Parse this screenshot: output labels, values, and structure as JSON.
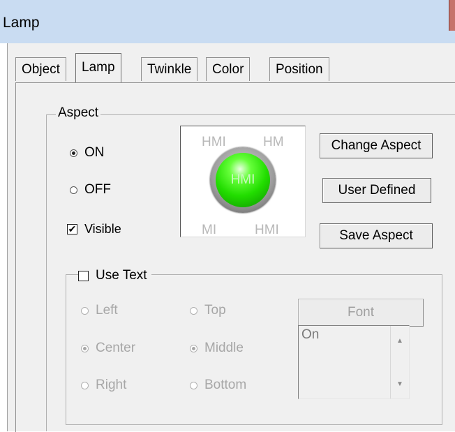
{
  "window": {
    "title": "Lamp"
  },
  "tabs": [
    "Object",
    "Lamp",
    "Twinkle",
    "Color",
    "Position"
  ],
  "active_tab": "Lamp",
  "aspect": {
    "group_label": "Aspect",
    "on_label": "ON",
    "off_label": "OFF",
    "visible_label": "Visible",
    "visible_checked": true,
    "preview": {
      "lamp_text": "HMI",
      "ghost_texts": [
        "HMI",
        "HM",
        "MI",
        "HMI"
      ]
    },
    "buttons": {
      "change_aspect": "Change Aspect",
      "user_defined": "User Defined",
      "save_aspect": "Save Aspect"
    }
  },
  "use_text": {
    "label": "Use Text",
    "checked": false,
    "horizontal": {
      "left": "Left",
      "center": "Center",
      "right": "Right",
      "selected": "Center"
    },
    "vertical": {
      "top": "Top",
      "middle": "Middle",
      "bottom": "Bottom",
      "selected": "Middle"
    },
    "font_button": "Font",
    "text_value": "On"
  },
  "icons": {
    "scroll_up": "scroll-up-arrow-icon",
    "scroll_down": "scroll-down-arrow-icon",
    "checkmark": "checkmark-icon"
  },
  "colors": {
    "titlebar": "#c9dcf2",
    "dialog": "#f0f0f0",
    "lamp_green": "#22dd00"
  }
}
